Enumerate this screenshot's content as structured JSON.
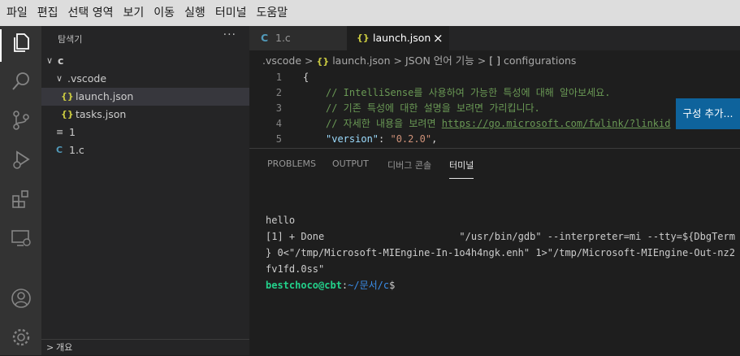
{
  "menubar": {
    "items": [
      "파일",
      "편집",
      "선택 영역",
      "보기",
      "이동",
      "실행",
      "터미널",
      "도움말"
    ]
  },
  "activitybar": {
    "icons": [
      "explorer-icon",
      "search-icon",
      "source-control-icon",
      "run-debug-icon",
      "extensions-icon",
      "remote-explorer-icon",
      "accounts-icon",
      "settings-gear-icon"
    ]
  },
  "sidebar": {
    "title": "탐색기",
    "more": "···",
    "tree": [
      {
        "label": "c",
        "chev": "∨",
        "icon": ""
      },
      {
        "label": ".vscode",
        "chev": "∨",
        "icon": ""
      },
      {
        "label": "launch.json",
        "chev": "",
        "icon": "{}"
      },
      {
        "label": "tasks.json",
        "chev": "",
        "icon": "{}"
      },
      {
        "label": "1",
        "chev": "",
        "icon": "≡"
      },
      {
        "label": "1.c",
        "chev": "",
        "icon": "C"
      }
    ],
    "outline": {
      "chev": ">",
      "label": "개요"
    }
  },
  "tabs": [
    {
      "icon": "C",
      "label": "1.c"
    },
    {
      "icon": "{}",
      "label": "launch.json",
      "close": "×"
    }
  ],
  "breadcrumb": {
    "items": [
      ".vscode",
      ">",
      "{}",
      "launch.json",
      ">",
      "JSON 언어 기능",
      ">",
      "[ ]",
      "configurations"
    ]
  },
  "editor": {
    "line_numbers": [
      "1",
      "2",
      "3",
      "4",
      "5"
    ],
    "lines": {
      "l1": "{",
      "l2": "// IntelliSense를 사용하여 가능한 특성에 대해 알아보세요.",
      "l3": "// 기존 특성에 대한 설명을 보려면 가리킵니다.",
      "l4_prefix": "// 자세한 내용을 보려면 ",
      "l4_link": "https://go.microsoft.com/fwlink/?linkid",
      "l5_key": "\"version\"",
      "l5_colon": ": ",
      "l5_value": "\"0.2.0\"",
      "l5_comma": ","
    },
    "add_config_button": "구성 추가..."
  },
  "colors": {
    "accent": "#0e639c",
    "comment": "#6a9955",
    "key": "#9cdcfe",
    "string": "#ce9178",
    "terminal_user": "#23d18b",
    "terminal_path": "#3b8eea"
  },
  "panel": {
    "tabs": [
      "PROBLEMS",
      "OUTPUT",
      "디버그 콘솔",
      "터미널"
    ],
    "active_tab": "터미널"
  },
  "terminal": {
    "line1": "hello",
    "line2": "[1] + Done                       \"/usr/bin/gdb\" --interpreter=mi --tty=${DbgTerm",
    "line3": "} 0<\"/tmp/Microsoft-MIEngine-In-1o4h4ngk.enh\" 1>\"/tmp/Microsoft-MIEngine-Out-nz2",
    "line4": "fv1fd.0ss\"",
    "prompt_user": "bestchoco@cbt",
    "prompt_colon": ":",
    "prompt_path": "~/문서/c",
    "prompt_dollar": "$"
  }
}
